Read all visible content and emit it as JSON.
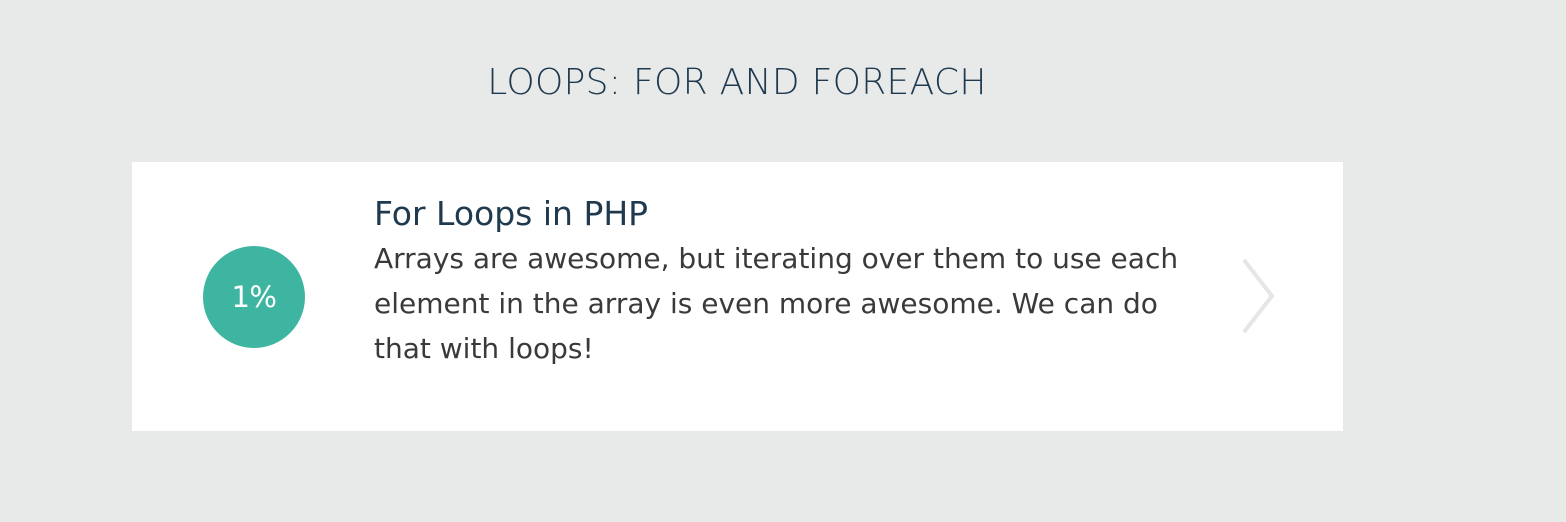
{
  "section": {
    "title": "LOOPS: FOR AND FOREACH"
  },
  "lesson": {
    "progress_label": "1%",
    "progress_value": 0.01,
    "title": "For Loops in PHP",
    "description": "Arrays are awesome, but iterating over them to use each element in the array is even more awesome. We can do that with loops!",
    "next_icon": "chevron-right-icon"
  },
  "colors": {
    "background": "#e8eaea",
    "card": "#ffffff",
    "accent": "#3eb5a0",
    "title_text": "#1f3a4f",
    "body_text": "#3a3a3a",
    "chevron": "#e6e6e6"
  }
}
